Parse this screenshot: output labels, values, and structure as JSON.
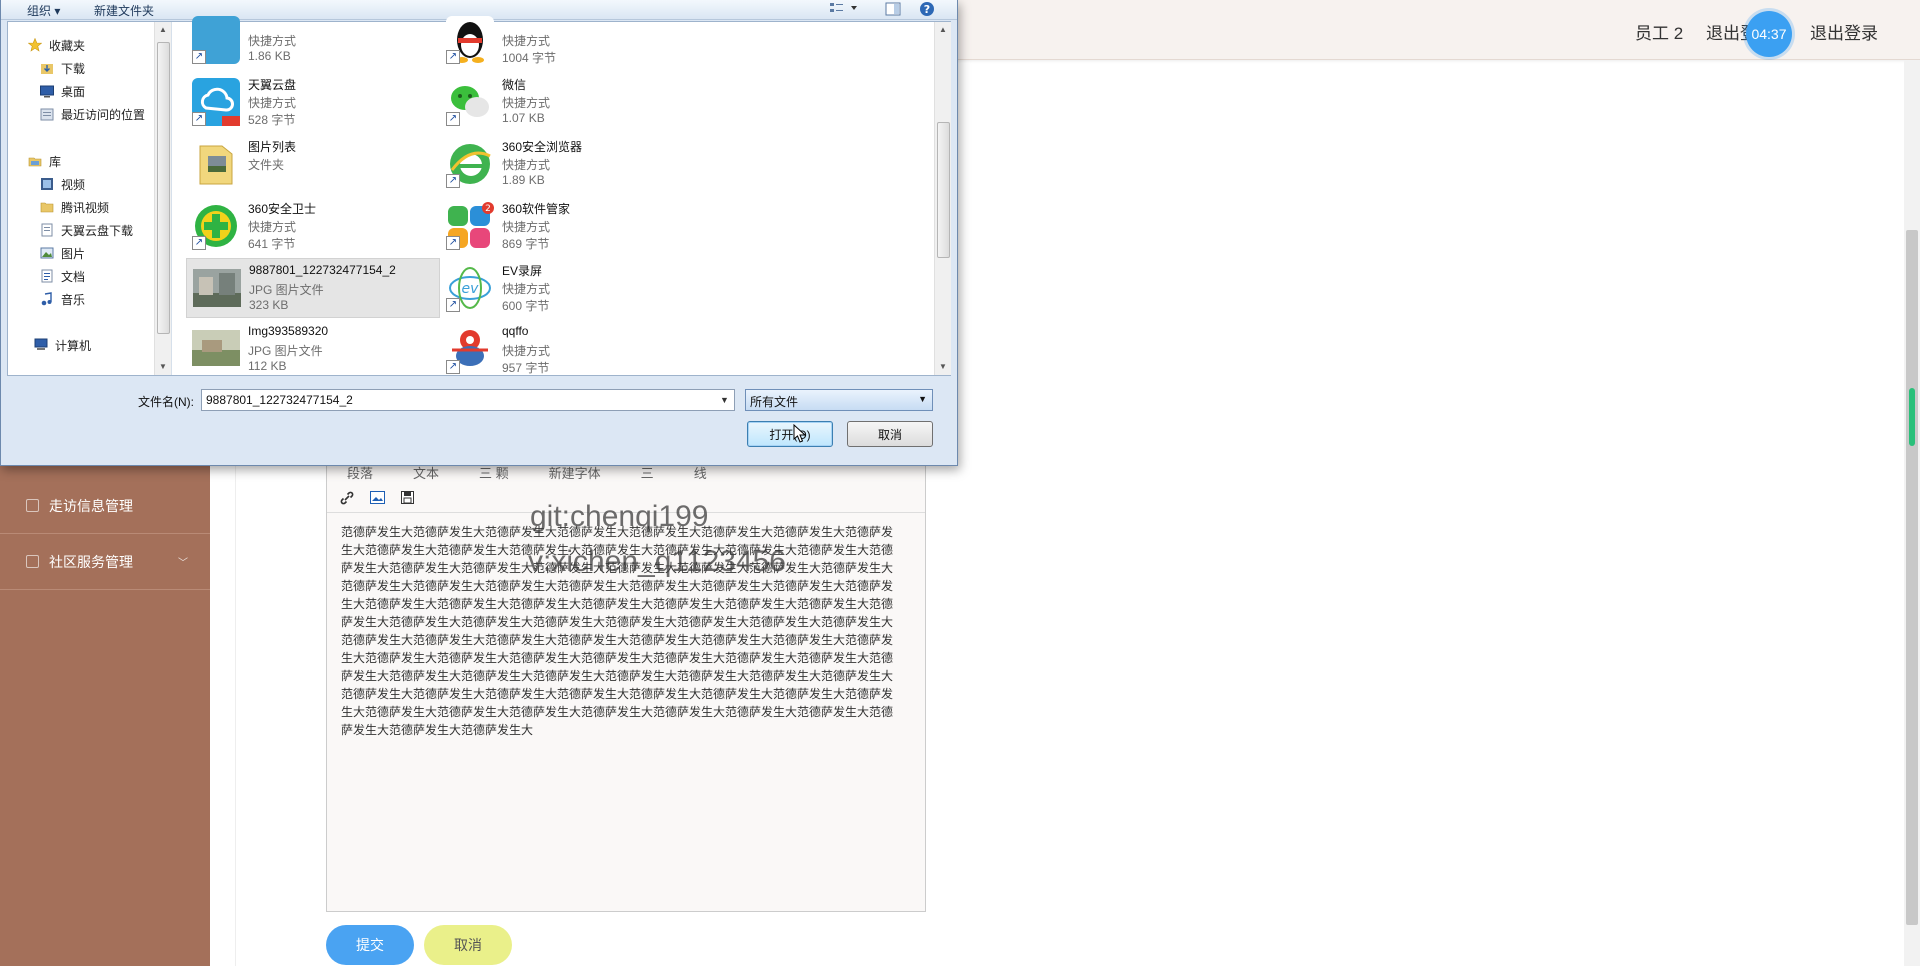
{
  "header": {
    "user": "员工 2",
    "logout_partial": "退出登",
    "timer": "04:37",
    "logout": "退出登录"
  },
  "sidebar": {
    "items": [
      {
        "label": "走访信息管理"
      },
      {
        "label": "社区服务管理"
      }
    ]
  },
  "editor": {
    "toolbar_row1": [
      "段落",
      "文本",
      "三 颗",
      "新建字体",
      "三",
      "线"
    ],
    "body_text": "范德萨发生大范德萨发生大范德萨发生大范德萨发生大范德萨发生大范德萨发生大范德萨发生大范德萨发生大范德萨发生大范德萨发生大范德萨发生大范德萨发生大范德萨发生大范德萨发生大范德萨发生大范德萨发生大范德萨发生大范德萨发生大范德萨发生大范德萨发生大范德萨发生大范德萨发生大范德萨发生大范德萨发生大范德萨发生大范德萨发生大范德萨发生大范德萨发生大范德萨发生大范德萨发生大范德萨发生大范德萨发生大范德萨发生大范德萨发生大范德萨发生大范德萨发生大范德萨发生大范德萨发生大范德萨发生大范德萨发生大范德萨发生大范德萨发生大范德萨发生大范德萨发生大范德萨发生大范德萨发生大范德萨发生大范德萨发生大范德萨发生大范德萨发生大范德萨发生大范德萨发生大范德萨发生大范德萨发生大范德萨发生大范德萨发生大范德萨发生大范德萨发生大范德萨发生大范德萨发生大范德萨发生大范德萨发生大范德萨发生大范德萨发生大范德萨发生大范德萨发生大范德萨发生大范德萨发生大范德萨发生大范德萨发生大范德萨发生大范德萨发生大范德萨发生大范德萨发生大范德萨发生大范德萨发生大范德萨发生大范德萨发生大范德萨发生大范德萨发生大范德萨发生大范德萨发生大范德萨发生大范德萨发生大范德萨发生大范德萨发生大范德萨发生大"
  },
  "watermark": {
    "line1": "git:chenqi199",
    "line2": "v:xichen_q1123456"
  },
  "form_buttons": {
    "submit": "提交",
    "cancel": "取消"
  },
  "dialog": {
    "toolbar": {
      "organize": "组织 ▾",
      "new_folder": "新建文件夹"
    },
    "nav": {
      "favorites": "收藏夹",
      "downloads": "下载",
      "desktop": "桌面",
      "recent": "最近访问的位置",
      "libraries": "库",
      "videos": "视频",
      "tencent_video": "腾讯视频",
      "tianyi_downloads": "天翼云盘下载",
      "pictures": "图片",
      "documents": "文档",
      "music": "音乐",
      "computer": "计算机"
    },
    "files": [
      {
        "name": "",
        "type": "快捷方式",
        "size": "1.86 KB"
      },
      {
        "name": "",
        "type": "快捷方式",
        "size": "1004 字节"
      },
      {
        "name": "天翼云盘",
        "type": "快捷方式",
        "size": "528 字节"
      },
      {
        "name": "微信",
        "type": "快捷方式",
        "size": "1.07 KB"
      },
      {
        "name": "图片列表",
        "type": "文件夹",
        "size": ""
      },
      {
        "name": "360安全浏览器",
        "type": "快捷方式",
        "size": "1.89 KB"
      },
      {
        "name": "360安全卫士",
        "type": "快捷方式",
        "size": "641 字节"
      },
      {
        "name": "360软件管家",
        "type": "快捷方式",
        "size": "869 字节"
      },
      {
        "name": "9887801_122732477154_2",
        "type": "JPG 图片文件",
        "size": "323 KB"
      },
      {
        "name": "EV录屏",
        "type": "快捷方式",
        "size": "600 字节"
      },
      {
        "name": "Img393589320",
        "type": "JPG 图片文件",
        "size": "112 KB"
      },
      {
        "name": "qqffo",
        "type": "快捷方式",
        "size": "957 字节"
      }
    ],
    "filename_label": "文件名(N):",
    "filename_value": "9887801_122732477154_2",
    "filetype_value": "所有文件",
    "open_button": "打开(O)",
    "cancel_button": "取消"
  }
}
